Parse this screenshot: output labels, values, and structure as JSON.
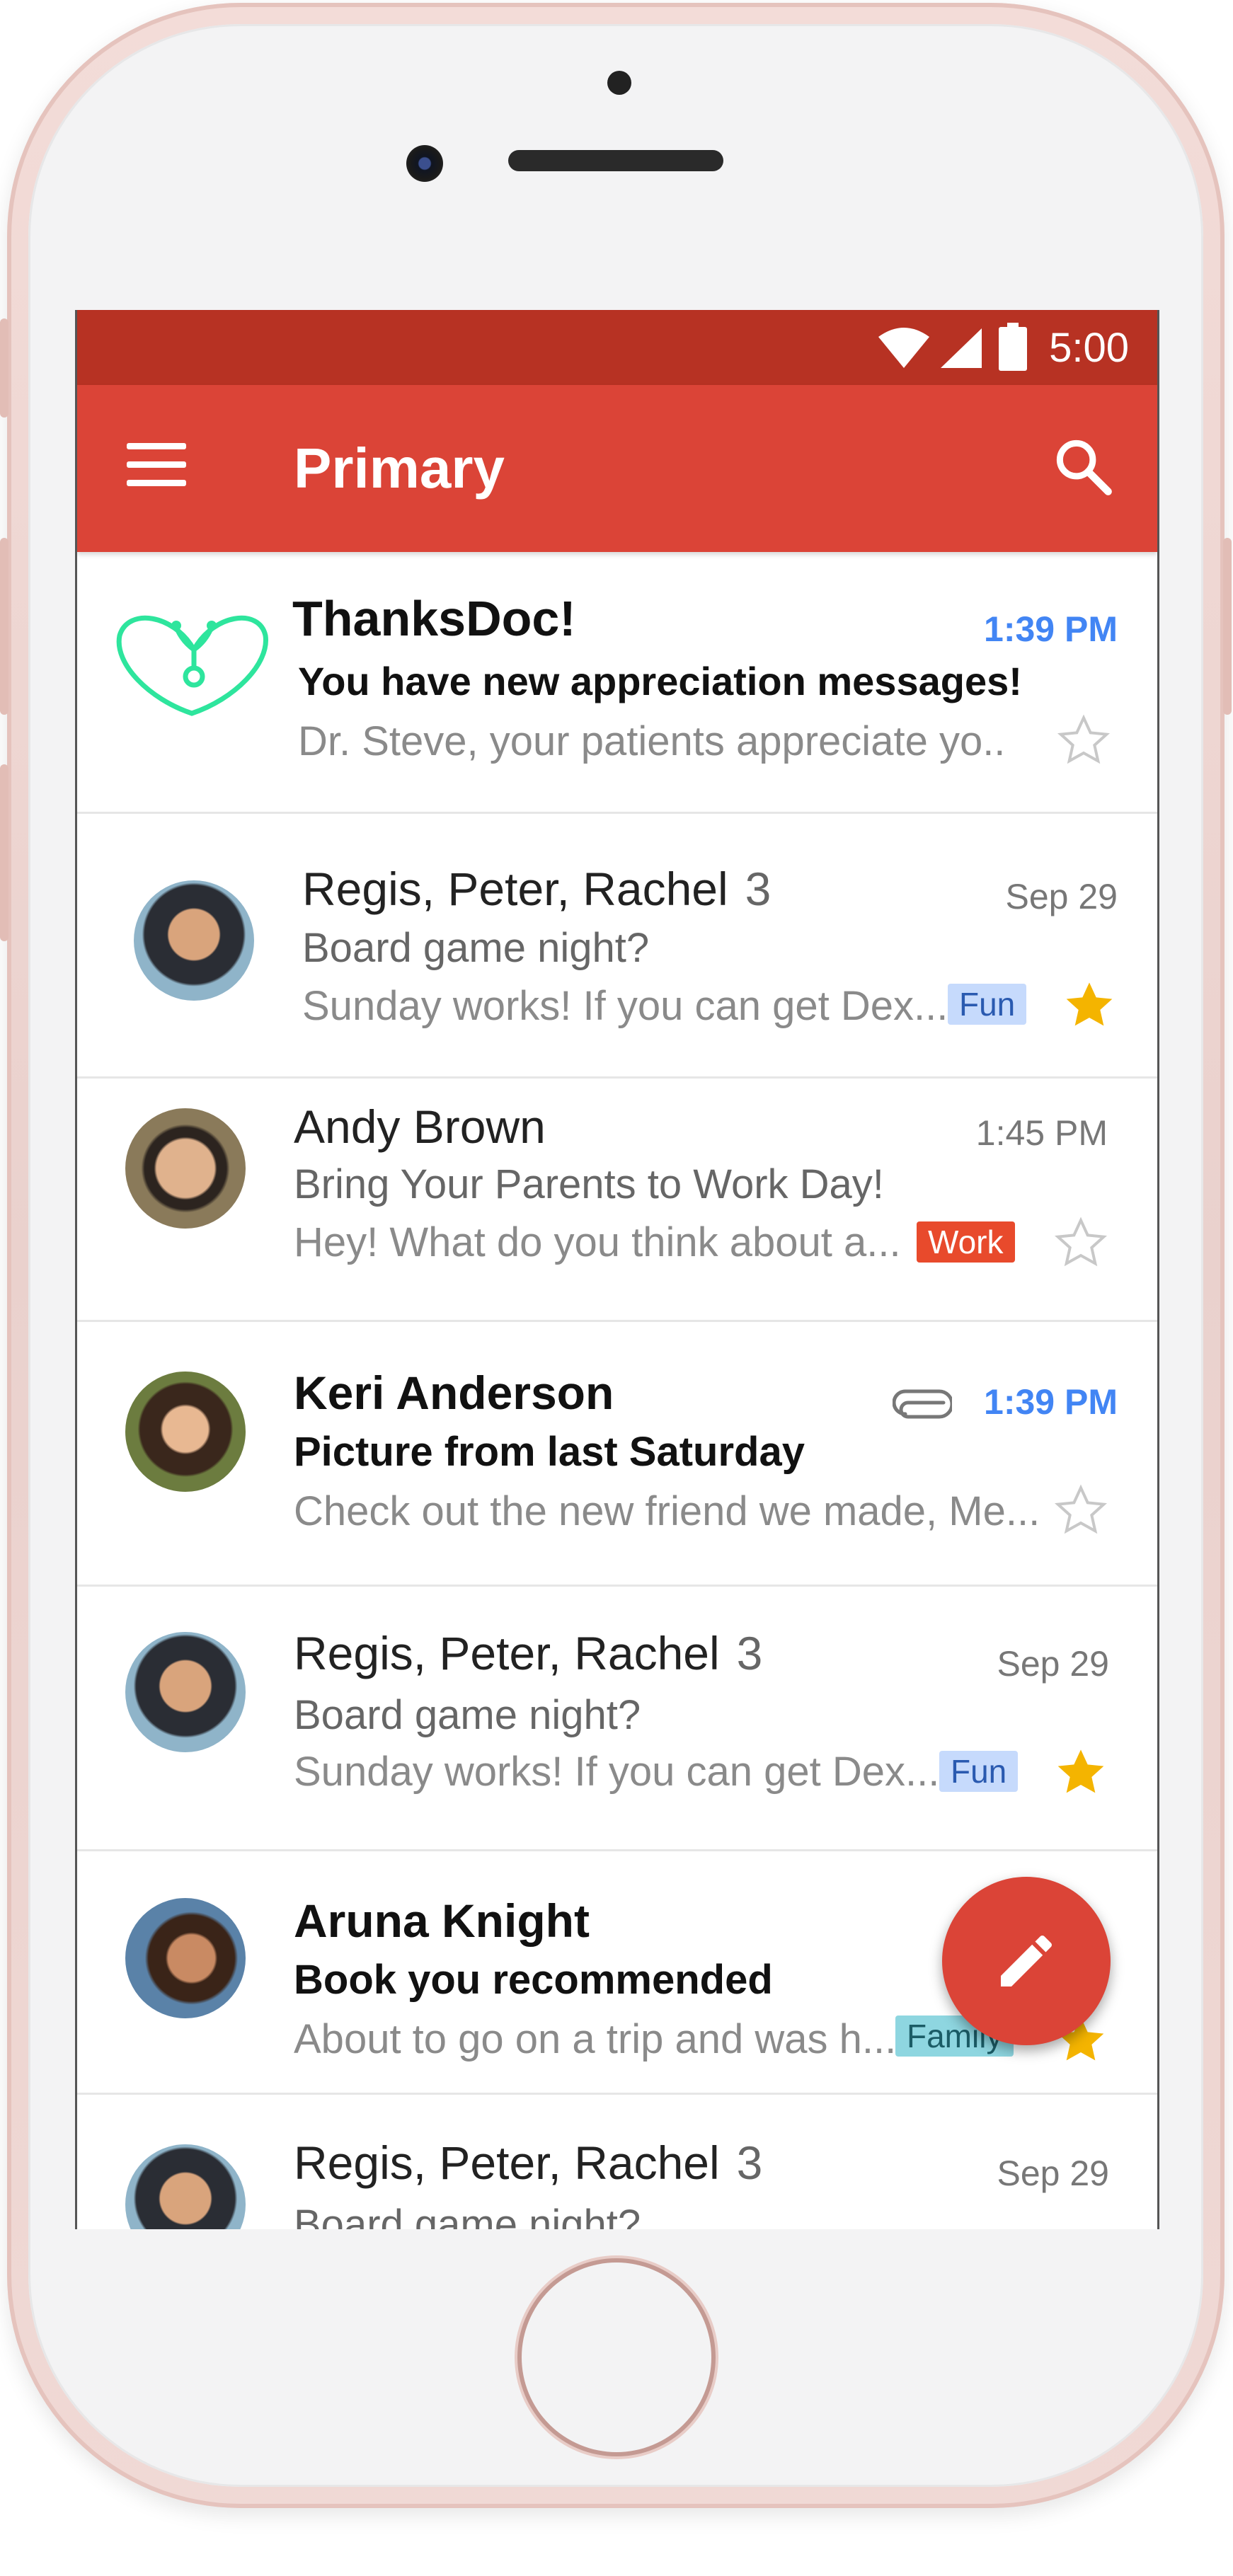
{
  "status_bar": {
    "time": "5:00"
  },
  "app_bar": {
    "title": "Primary"
  },
  "emails": [
    {
      "sender": "ThanksDoc!",
      "count": "",
      "subject": "You have new appreciation messages!",
      "snippet": "Dr. Steve, your patients appreciate yo..",
      "time": "1:39 PM",
      "tag": "",
      "starred": false,
      "unread": true
    },
    {
      "sender": "Regis, Peter, Rachel",
      "count": "3",
      "subject": "Board game night?",
      "snippet": "Sunday works! If you can get Dex...",
      "time": "Sep 29",
      "tag": "Fun",
      "starred": true,
      "unread": false
    },
    {
      "sender": "Andy Brown",
      "count": "",
      "subject": "Bring Your Parents to Work Day!",
      "snippet": "Hey! What do you think about a...",
      "time": "1:45 PM",
      "tag": "Work",
      "starred": false,
      "unread": false
    },
    {
      "sender": "Keri Anderson",
      "count": "",
      "subject": "Picture from last Saturday",
      "snippet": "Check out the new friend we made, Me...",
      "time": "1:39 PM",
      "tag": "",
      "starred": false,
      "unread": true,
      "attachment": true
    },
    {
      "sender": "Regis, Peter, Rachel",
      "count": "3",
      "subject": "Board game night?",
      "snippet": "Sunday works! If you can get Dex...",
      "time": "Sep 29",
      "tag": "Fun",
      "starred": true,
      "unread": false
    },
    {
      "sender": "Aruna Knight",
      "count": "",
      "subject": "Book you recommended",
      "snippet": "About to go on a trip and was h...",
      "time": "",
      "tag": "Family",
      "starred": true,
      "unread": true
    },
    {
      "sender": "Regis, Peter, Rachel",
      "count": "3",
      "subject": "Board game night?",
      "snippet": "",
      "time": "Sep 29",
      "tag": "",
      "starred": false,
      "unread": false
    }
  ],
  "colors": {
    "status_bar": "#b73223",
    "app_bar": "#db4437",
    "unread_time": "#4285f4",
    "star": "#f4b400",
    "tag_fun": "#c6dafc",
    "tag_work": "#e84a2c",
    "tag_family": "#8ed6e0",
    "logo": "#2ee59d"
  },
  "icons": {
    "menu": "hamburger-icon",
    "search": "search-icon",
    "compose": "pencil-icon",
    "attachment": "paperclip-icon",
    "star": "star-icon"
  }
}
